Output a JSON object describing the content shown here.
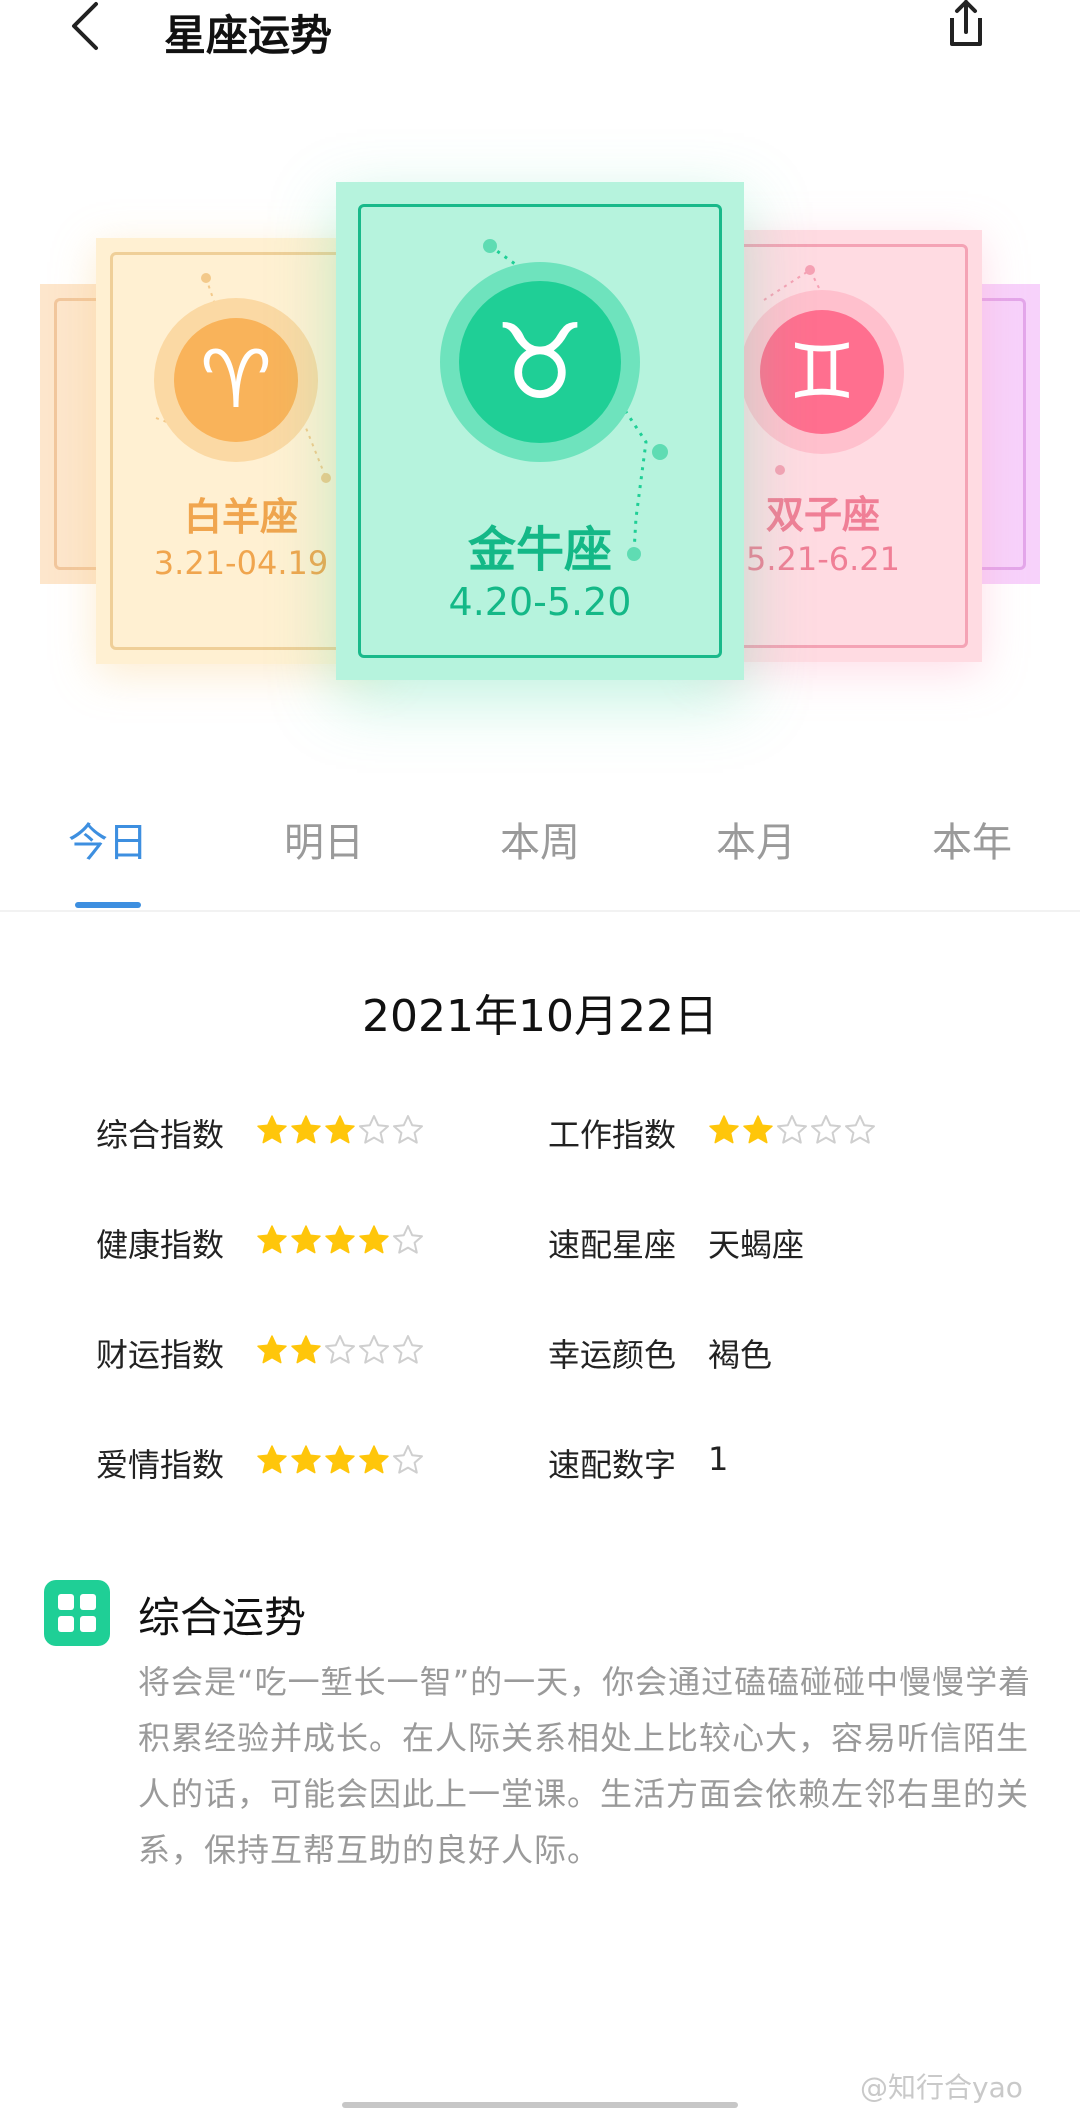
{
  "header": {
    "title": "星座运势"
  },
  "cards": {
    "aries": {
      "name": "白羊座",
      "dates": "3.21-04.19",
      "color": "#f9b35a"
    },
    "taurus": {
      "name": "金牛座",
      "dates": "4.20-5.20",
      "color": "#1fcf96"
    },
    "gemini": {
      "name": "双子座",
      "dates": "5.21-6.21",
      "color": "#ff6f8f"
    }
  },
  "tabs": [
    "今日",
    "明日",
    "本周",
    "本月",
    "本年"
  ],
  "active_tab": "今日",
  "date": "2021年10月22日",
  "indices": {
    "overall": {
      "label": "综合指数",
      "stars": 3,
      "max": 5
    },
    "health": {
      "label": "健康指数",
      "stars": 4,
      "max": 5
    },
    "wealth": {
      "label": "财运指数",
      "stars": 2,
      "max": 5
    },
    "love": {
      "label": "爱情指数",
      "stars": 4,
      "max": 5
    },
    "work": {
      "label": "工作指数",
      "stars": 2,
      "max": 5
    },
    "match_sign": {
      "label": "速配星座",
      "value": "天蝎座"
    },
    "lucky_color": {
      "label": "幸运颜色",
      "value": "褐色"
    },
    "lucky_number": {
      "label": "速配数字",
      "value": "1"
    }
  },
  "fortune": {
    "title": "综合运势",
    "text": "将会是“吃一堑长一智”的一天，你会通过磕磕碰碰中慢慢学着积累经验并成长。在人际关系相处上比较心大，容易听信陌生人的话，可能会因此上一堂课。生活方面会依赖左邻右里的关系，保持互帮互助的良好人际。"
  },
  "watermark": "@知行合yao",
  "colors": {
    "accent": "#3d8fe0",
    "star": "#ffc60a",
    "star_empty": "#cfcfcf"
  }
}
